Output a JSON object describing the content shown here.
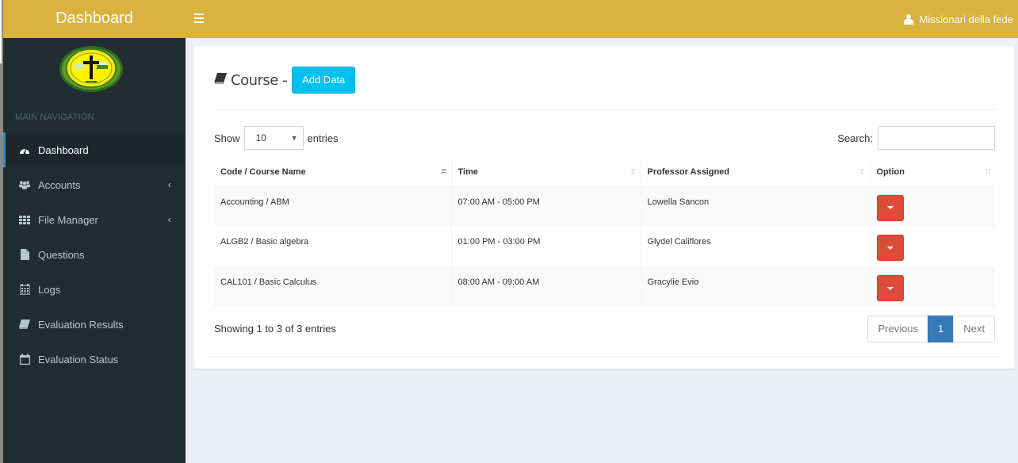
{
  "header": {
    "app_title": "Dashboard",
    "menu_toggle_icon": "hamburger-icon",
    "user_name": "Missionari della fede",
    "user_icon": "user-icon"
  },
  "sidebar": {
    "logo_alt": "Missionari della fede emblem",
    "nav_header": "MAIN NAVIGATION",
    "items": [
      {
        "label": "Dashboard",
        "icon": "dashboard-icon",
        "active": true,
        "has_submenu": false
      },
      {
        "label": "Accounts",
        "icon": "users-icon",
        "active": false,
        "has_submenu": true
      },
      {
        "label": "File Manager",
        "icon": "grid-icon",
        "active": false,
        "has_submenu": true
      },
      {
        "label": "Questions",
        "icon": "file-icon",
        "active": false,
        "has_submenu": false
      },
      {
        "label": "Logs",
        "icon": "calendar-icon",
        "active": false,
        "has_submenu": false
      },
      {
        "label": "Evaluation Results",
        "icon": "book-icon",
        "active": false,
        "has_submenu": false
      },
      {
        "label": "Evaluation Status",
        "icon": "calendar-empty-icon",
        "active": false,
        "has_submenu": false
      }
    ],
    "chevron": "‹"
  },
  "content": {
    "title": "Course -",
    "add_button": "Add Data",
    "length": {
      "show_label": "Show",
      "selected": "10",
      "entries_label": "entries"
    },
    "search": {
      "label": "Search:",
      "value": "",
      "placeholder": ""
    },
    "table": {
      "columns": [
        "Code / Course Name",
        "Time",
        "Professor Assigned",
        "Option"
      ],
      "sorted_column": 0,
      "rows": [
        {
          "course": "Accounting / ABM",
          "time": "07:00 AM - 05:00 PM",
          "professor": "Lowella Sancon"
        },
        {
          "course": "ALGB2 / Basic algebra",
          "time": "01:00 PM - 03:00 PM",
          "professor": "Glydel Califlores"
        },
        {
          "course": "CAL101 / Basic Calculus",
          "time": "08:00 AM - 09:00 AM",
          "professor": "Gracylie Evio"
        }
      ]
    },
    "info": "Showing 1 to 3 of 3 entries",
    "pagination": {
      "previous": "Previous",
      "current": "1",
      "next": "Next"
    }
  },
  "colors": {
    "header": "#d9b240",
    "sidebar": "#222d32",
    "add_button": "#00c0ef",
    "option_button": "#dd4b39",
    "pagination_active": "#337ab7",
    "sidebar_active_border": "#3c8dbc"
  }
}
